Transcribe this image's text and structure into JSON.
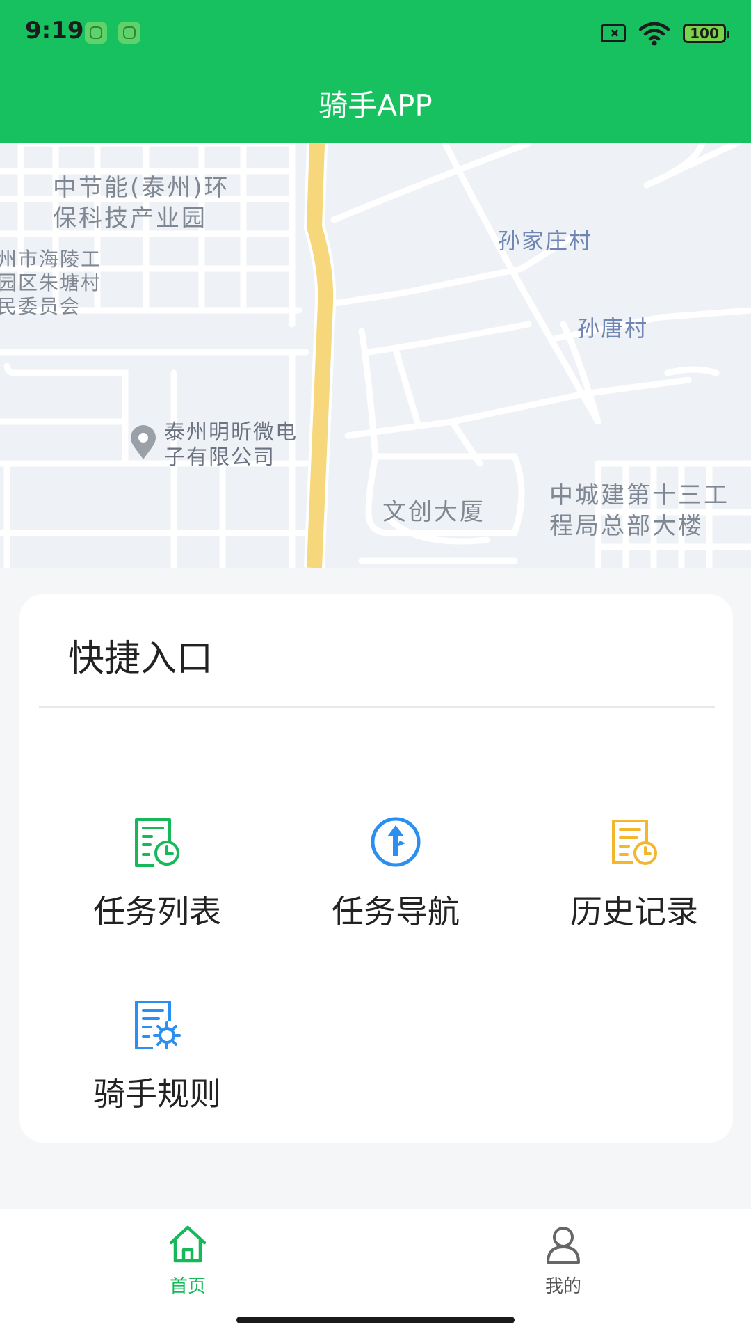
{
  "status_bar": {
    "time": "9:19",
    "battery": "100"
  },
  "header": {
    "title": "骑手APP"
  },
  "map": {
    "labels": {
      "park": "中节能(泰州)环\n保科技产业园",
      "committee": "州市海陵工\n园区朱塘村\n民委员会",
      "sunjiazhuang": "孙家庄村",
      "suntang": "孙唐村",
      "company": "泰州明昕微电\n子有限公司",
      "wenchuang": "文创大厦",
      "zhongchengjian": "中城建第十三工\n程局总部大楼"
    }
  },
  "quick": {
    "title": "快捷入口",
    "items": [
      {
        "label": "任务列表",
        "icon": "task-list-icon",
        "color": "#17b85a"
      },
      {
        "label": "任务导航",
        "icon": "navigation-icon",
        "color": "#2a8ff0"
      },
      {
        "label": "历史记录",
        "icon": "history-icon",
        "color": "#f2b62f"
      },
      {
        "label": "骑手规则",
        "icon": "rules-icon",
        "color": "#2a8ff0"
      }
    ]
  },
  "tabbar": {
    "tabs": [
      {
        "label": "首页",
        "icon": "home-icon",
        "active": true
      },
      {
        "label": "我的",
        "icon": "profile-icon",
        "active": false
      }
    ]
  },
  "colors": {
    "brand": "#17c160",
    "active_tab": "#17b85a",
    "inactive_tab": "#555555"
  }
}
